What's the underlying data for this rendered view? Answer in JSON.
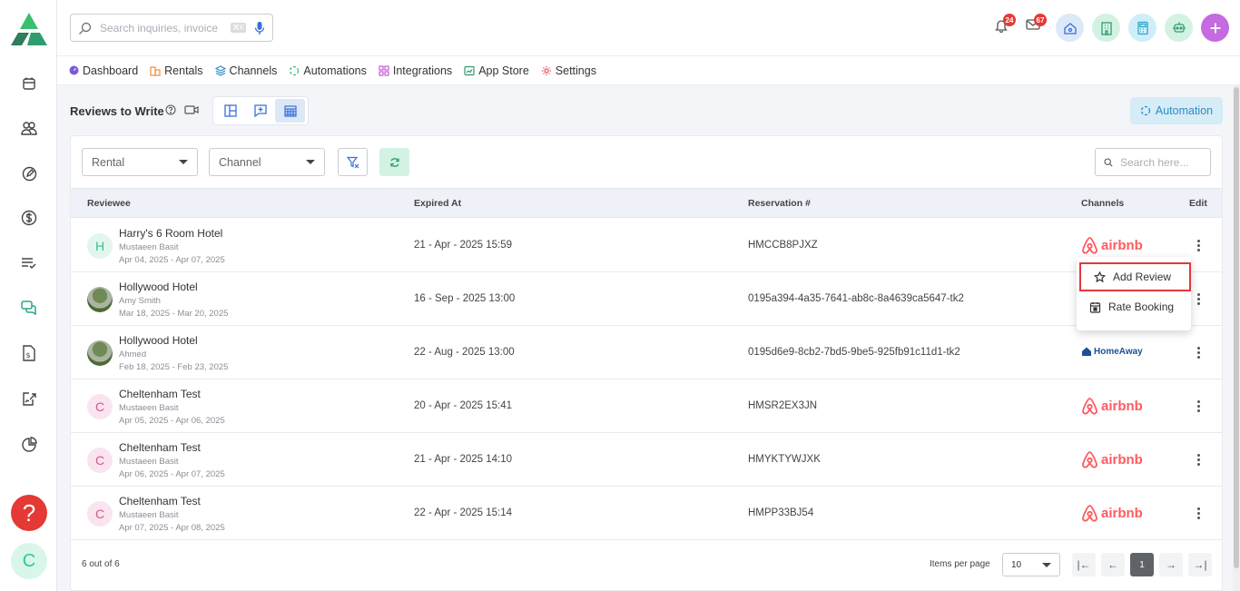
{
  "search": {
    "placeholder": "Search inquiries, invoice",
    "shortcut": "⌘K"
  },
  "notifications": {
    "bell_count": "24",
    "mail_count": "67"
  },
  "nav": {
    "items": [
      {
        "label": "Dashboard",
        "icon": "dashboard-icon",
        "color": "#7c5cd6"
      },
      {
        "label": "Rentals",
        "icon": "rentals-icon",
        "color": "#f08b3a"
      },
      {
        "label": "Channels",
        "icon": "channels-icon",
        "color": "#2a8bc3"
      },
      {
        "label": "Automations",
        "icon": "automations-icon",
        "color": "#3bbf6e"
      },
      {
        "label": "Integrations",
        "icon": "integrations-icon",
        "color": "#c85bd6"
      },
      {
        "label": "App Store",
        "icon": "app-store-icon",
        "color": "#2e9c6f"
      },
      {
        "label": "Settings",
        "icon": "settings-icon",
        "color": "#e0566a"
      }
    ]
  },
  "page": {
    "title": "Reviews to Write",
    "automation_label": "Automation"
  },
  "filters": {
    "rental": "Rental",
    "channel": "Channel",
    "search_placeholder": "Search here..."
  },
  "table": {
    "headers": {
      "reviewee": "Reviewee",
      "expired": "Expired At",
      "reservation": "Reservation #",
      "channels": "Channels",
      "edit": "Edit"
    },
    "rows": [
      {
        "avatar": "H",
        "avatar_type": "h",
        "name": "Harry's 6 Room Hotel",
        "guest": "Mustaeen Basit",
        "dates": "Apr 04, 2025 - Apr 07, 2025",
        "expired": "21 - Apr - 2025 15:59",
        "reservation": "HMCCB8PJXZ",
        "channel": "airbnb"
      },
      {
        "avatar": "",
        "avatar_type": "img",
        "name": "Hollywood Hotel",
        "guest": "Amy Smith",
        "dates": "Mar 18, 2025 - Mar 20, 2025",
        "expired": "16 - Sep - 2025 13:00",
        "reservation": "0195a394-4a35-7641-ab8c-8a4639ca5647-tk2",
        "channel": ""
      },
      {
        "avatar": "",
        "avatar_type": "img",
        "name": "Hollywood Hotel",
        "guest": "Ahmed",
        "dates": "Feb 18, 2025 - Feb 23, 2025",
        "expired": "22 - Aug - 2025 13:00",
        "reservation": "0195d6e9-8cb2-7bd5-9be5-925fb91c11d1-tk2",
        "channel": "HomeAway"
      },
      {
        "avatar": "C",
        "avatar_type": "c",
        "name": "Cheltenham Test",
        "guest": "Mustaeen Basit",
        "dates": "Apr 05, 2025 - Apr 06, 2025",
        "expired": "20 - Apr - 2025 15:41",
        "reservation": "HMSR2EX3JN",
        "channel": "airbnb"
      },
      {
        "avatar": "C",
        "avatar_type": "c",
        "name": "Cheltenham Test",
        "guest": "Mustaeen Basit",
        "dates": "Apr 06, 2025 - Apr 07, 2025",
        "expired": "21 - Apr - 2025 14:10",
        "reservation": "HMYKTYWJXK",
        "channel": "airbnb"
      },
      {
        "avatar": "C",
        "avatar_type": "c",
        "name": "Cheltenham Test",
        "guest": "Mustaeen Basit",
        "dates": "Apr 07, 2025 - Apr 08, 2025",
        "expired": "22 - Apr - 2025 15:14",
        "reservation": "HMPP33BJ54",
        "channel": "airbnb"
      }
    ]
  },
  "dropdown": {
    "add_review": "Add Review",
    "rate_booking": "Rate Booking"
  },
  "footer": {
    "count": "6 out of 6",
    "items_per_page_label": "Items per page",
    "items_per_page": "10",
    "current_page": "1",
    "first": "|←",
    "prev": "←",
    "next": "→",
    "last": "→|"
  },
  "user": {
    "initial": "C"
  },
  "help": {
    "label": "?"
  }
}
